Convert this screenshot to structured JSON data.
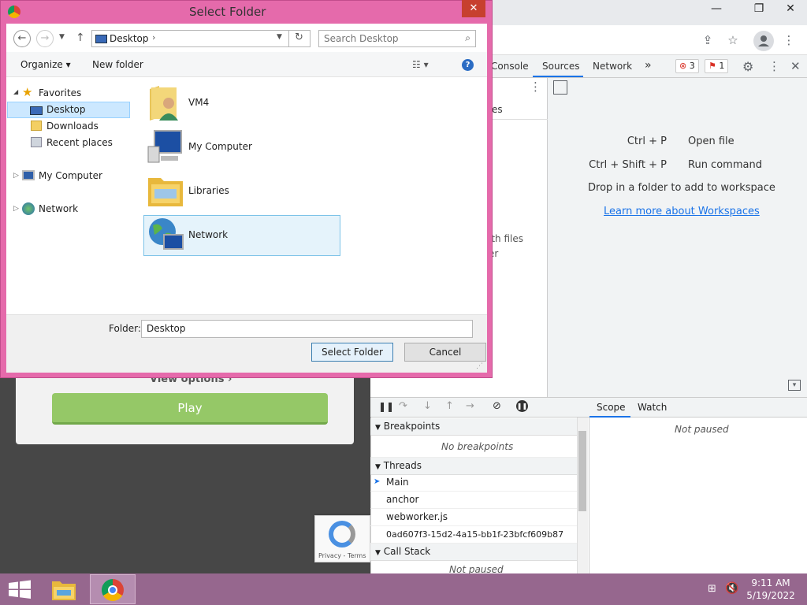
{
  "dialog": {
    "title": "Select Folder",
    "close_label": "✕",
    "path": "Desktop",
    "search_placeholder": "Search Desktop",
    "organize_label": "Organize ▾",
    "new_folder_label": "New folder",
    "tree": {
      "favorites": "Favorites",
      "desktop": "Desktop",
      "downloads": "Downloads",
      "recent": "Recent places",
      "my_computer": "My Computer",
      "network": "Network"
    },
    "files": [
      "VM4",
      "My Computer",
      "Libraries",
      "Network"
    ],
    "folder_label": "Folder:",
    "folder_value": "Desktop",
    "select_button": "Select Folder",
    "cancel_button": "Cancel"
  },
  "devtools": {
    "tabs": [
      "Console",
      "Sources",
      "Network"
    ],
    "more": "»",
    "error_count": "3",
    "issue_count": "1",
    "nav_partial_1": "es",
    "nav_partial_2": "ith files",
    "nav_partial_3": "er",
    "shortcuts": [
      {
        "key": "Ctrl + P",
        "desc": "Open file"
      },
      {
        "key": "Ctrl + Shift + P",
        "desc": "Run command"
      }
    ],
    "drop_text": "Drop in a folder to add to workspace",
    "workspace_link": "Learn more about Workspaces",
    "scope_tab": "Scope",
    "watch_tab": "Watch",
    "not_paused": "Not paused",
    "breakpoints_header": "Breakpoints",
    "no_breakpoints": "No breakpoints",
    "threads_header": "Threads",
    "threads": [
      "Main",
      "anchor",
      "webworker.js",
      "0ad607f3-15d2-4a15-bb1f-23bfcf609b87"
    ],
    "callstack_header": "Call Stack",
    "callstack_not_paused": "Not paused"
  },
  "page": {
    "view_options": "View options ›",
    "play_button": "Play",
    "recaptcha_text": "Privacy - Terms"
  },
  "taskbar": {
    "time": "9:11 AM",
    "date": "5/19/2022"
  },
  "colors": {
    "dialog_frame": "#e56aab",
    "taskbar": "#96678e",
    "play_button": "#95c867",
    "link": "#1a73e8"
  }
}
